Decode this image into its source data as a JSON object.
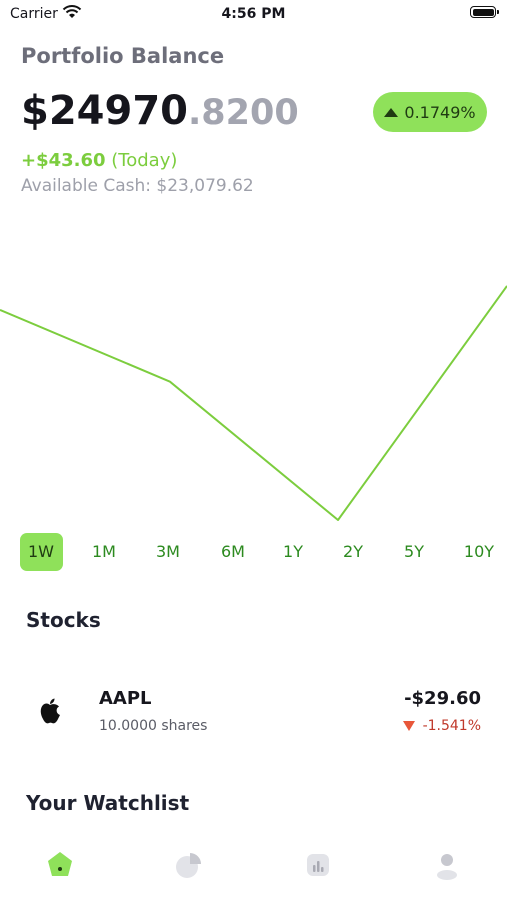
{
  "status_bar": {
    "carrier": "Carrier",
    "time": "4:56 PM"
  },
  "header": {
    "title": "Portfolio Balance",
    "balance_int": "$24970",
    "balance_dec": ".8200",
    "change_pct": "0.1749%",
    "today_amount": "+$43.60",
    "today_label": "(Today)",
    "cash_label": "Available Cash: $23,079.62"
  },
  "colors": {
    "accent": "#8fe15a",
    "line": "#7ccd3e",
    "range_text": "#2c8a1f",
    "negative": "#e8573a"
  },
  "ranges": [
    "1W",
    "1M",
    "3M",
    "6M",
    "1Y",
    "2Y",
    "5Y",
    "10Y"
  ],
  "selected_range": "1W",
  "chart_data": {
    "type": "line",
    "x": [
      0,
      1,
      2,
      3
    ],
    "series": [
      {
        "values": [
          0.79,
          0.52,
          0.0,
          0.88
        ]
      }
    ]
  },
  "stocks": {
    "title": "Stocks",
    "items": [
      {
        "icon": "apple-logo-icon",
        "symbol": "AAPL",
        "shares": "10.0000 shares",
        "pl": "-$29.60",
        "pct": "-1.541%"
      }
    ]
  },
  "watchlist": {
    "title": "Your Watchlist"
  },
  "tabs": [
    {
      "icon": "home-icon",
      "active": true
    },
    {
      "icon": "pie-chart-icon",
      "active": false
    },
    {
      "icon": "bar-chart-icon",
      "active": false
    },
    {
      "icon": "profile-icon",
      "active": false
    }
  ]
}
